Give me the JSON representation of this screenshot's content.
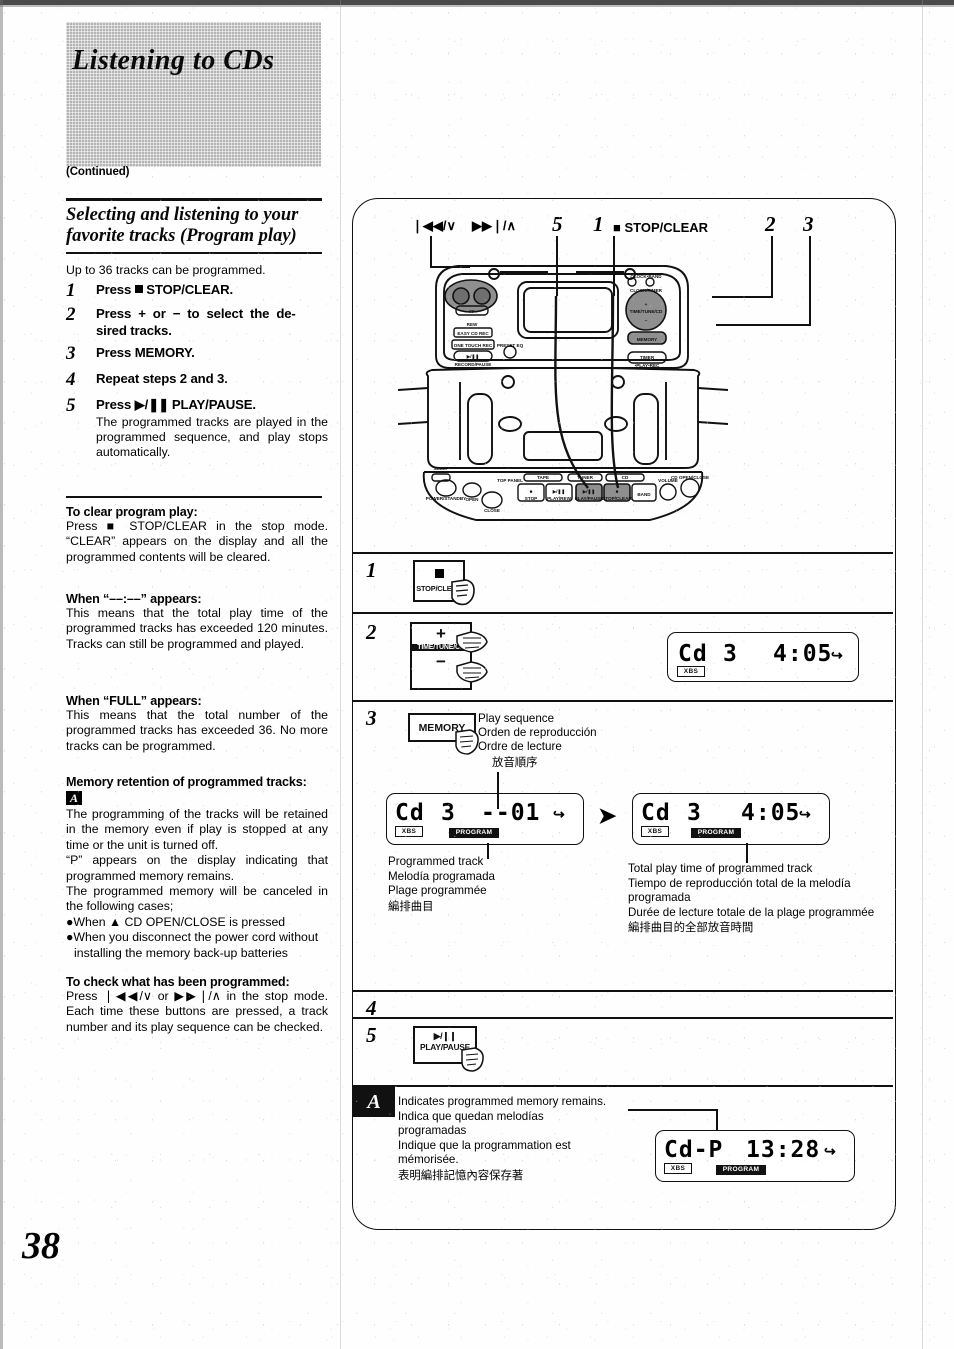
{
  "header": {
    "title": "Listening to CDs",
    "continued": "(Continued)"
  },
  "section": {
    "heading_line1": "Selecting and listening to your",
    "heading_line2": "favorite tracks (Program play)",
    "lead": "Up to 36 tracks can be programmed."
  },
  "steps": [
    {
      "num": "1",
      "text": "Press ■ STOP/CLEAR.",
      "detail": ""
    },
    {
      "num": "2",
      "text": "Press + or − to select the de-sired tracks.",
      "detail": ""
    },
    {
      "num": "3",
      "text": "Press MEMORY.",
      "detail": ""
    },
    {
      "num": "4",
      "text": "Repeat steps 2 and 3.",
      "detail": ""
    },
    {
      "num": "5",
      "text": "Press ▶/❙❙ PLAY/PAUSE.",
      "detail": "The programmed tracks are played in the programmed sequence, and play stops automatically."
    }
  ],
  "notes": [
    {
      "title": "To clear program play:",
      "body": "Press ■ STOP/CLEAR in the stop mode. “CLEAR” appears on the display and all the programmed contents will be cleared."
    },
    {
      "title": "When “––:––” appears:",
      "body": "This means that the total play time of the programmed tracks has exceeded 120 minutes. Tracks can still be programmed and played."
    },
    {
      "title": "When “FULL” appears:",
      "body": "This means that the total number of the programmed tracks has exceeded 36. No more tracks can be programmed."
    }
  ],
  "memory_note": {
    "title": "Memory retention of programmed tracks:",
    "badge": "A",
    "para1": "The programming of the tracks will be retained in the memory even if play is stopped at any time or the unit is turned off.",
    "para2": "“P” appears on the display indicating that programmed memory remains.",
    "para3": "The programmed memory will be canceled in the following cases;",
    "bullet1": "●When ▲ CD OPEN/CLOSE is pressed",
    "bullet2": "●When you disconnect the power cord without installing the memory back-up batteries"
  },
  "check_note": {
    "title": "To check what has been programmed:",
    "body": "Press ❘◀◀/∨ or ▶▶❘/∧ in the stop mode. Each time these buttons are pressed, a track number and its play sequence can be checked."
  },
  "page_number": "38",
  "diagram": {
    "top_labels": {
      "skip_back": "❘◀◀/∨",
      "skip_fwd": "▶▶❘/∧",
      "callout5": "5",
      "callout1": "1",
      "stop_clear": "■ STOP/CLEAR",
      "callout2": "2",
      "callout3": "3"
    },
    "device_panel_labels": {
      "fwd": "FF",
      "rew": "REW",
      "easy_cd_rec": "EASY CD REC",
      "one_touch_rec": "ONE TOUCH REC",
      "play_rec": "▶/❙❙ RECORD/PAUSE",
      "preset_eq": "PRESET EQ",
      "clock_timer_up": "CLOCK/TIMER",
      "time_tune_cd": "TIME/TUNE/CD",
      "memory": "MEMORY",
      "timer": "TIMER",
      "timer_sub": "• PLAY • REC",
      "plus": "+",
      "minus": "−",
      "open_close_bottom": "CLOSE",
      "open": "OPEN",
      "top_panel": "TOP PANEL",
      "power": "POWER/STANDBY",
      "tape": "TAPE",
      "tuner": "TUNER/BAND",
      "cd": "CD",
      "stop": "■ STOP",
      "play_pause": "▶/❙❙ PLAY/PAUSE",
      "band": "BAND",
      "volume": "VOLUME",
      "vol_plus": "+",
      "vol_minus": "−",
      "cd_open_close": "CD OPEN/CLOSE"
    }
  },
  "procedure_rows": [
    {
      "num": "1",
      "button": {
        "glyph": "■",
        "label": "STOP/CLEAR"
      }
    },
    {
      "num": "2",
      "button": {
        "plus": "+",
        "label": "TIME/TUNE/CD",
        "minus": "−"
      },
      "display": {
        "text": "Cd  3      4:05",
        "main": "Cd",
        "track": "3",
        "time": "4:05",
        "xbs": "XBS",
        "repeat": "↪",
        "program": ""
      }
    },
    {
      "num": "3",
      "button": {
        "label": "MEMORY"
      },
      "play_sequence_labels": {
        "en": "Play sequence",
        "es": "Orden de reproducción",
        "fr": "Ordre de lecture",
        "cjk": "放音順序"
      },
      "display_left": {
        "main": "Cd",
        "track": "3",
        "time": "--01",
        "xbs": "XBS",
        "program": "PROGRAM",
        "repeat": "↪"
      },
      "display_right": {
        "main": "Cd",
        "track": "3",
        "time": "4:05",
        "xbs": "XBS",
        "program": "PROGRAM",
        "repeat": "↪"
      },
      "caption_left": {
        "en": "Programmed track",
        "es": "Melodía programada",
        "fr": "Plage programmée",
        "cjk": "編排曲目"
      },
      "caption_right": {
        "en": "Total play time of programmed track",
        "es": "Tiempo de reproducción total de la melodía programada",
        "fr": "Durée de lecture totale de la plage programmée",
        "cjk": "編排曲目的全部放音時間"
      }
    },
    {
      "num": "4"
    },
    {
      "num": "5",
      "button": {
        "glyph": "▶/❙❙",
        "label": "PLAY/PAUSE"
      }
    }
  ],
  "note_a": {
    "badge": "A",
    "en": "Indicates programmed memory remains.",
    "es1": "Indica que quedan melodías",
    "es2": "programadas",
    "fr1": "Indique que la programmation est",
    "fr2": "mémorisée.",
    "cjk": "表明編排記憶內容保存著",
    "display": {
      "main": "Cd-P",
      "time": "13:28",
      "xbs": "XBS",
      "program": "PROGRAM",
      "repeat": "↪"
    }
  },
  "colors": {
    "ink": "#111111",
    "halftone": "#b4b4b4"
  }
}
